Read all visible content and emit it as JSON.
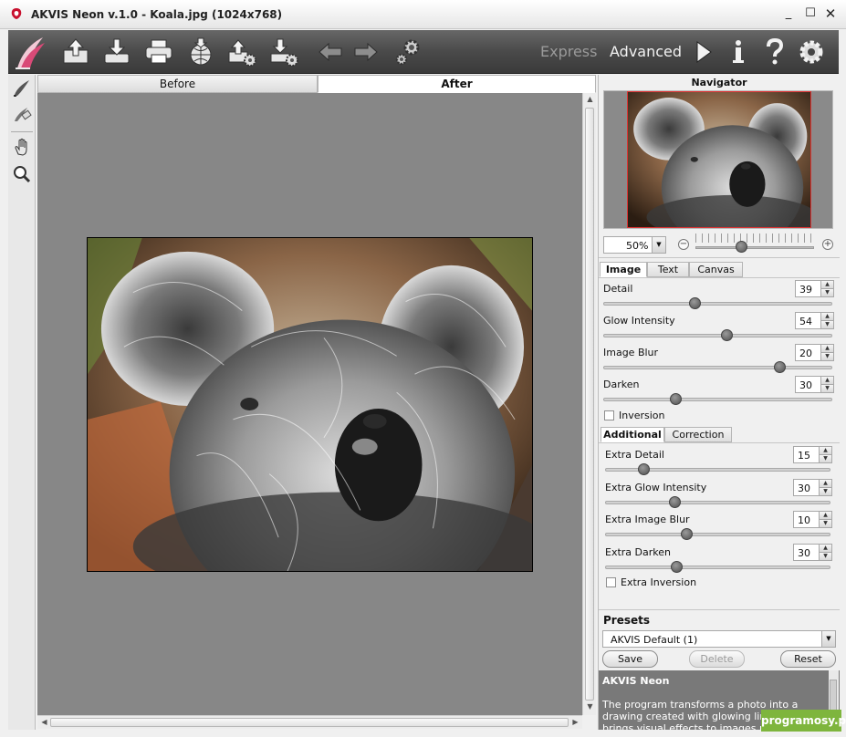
{
  "window": {
    "title": "AKVIS Neon v.1.0 - Koala.jpg (1024x768)",
    "minimize": "_",
    "maximize": "☐",
    "close": "✕"
  },
  "toolbar": {
    "mode_express": "Express",
    "mode_advanced": "Advanced"
  },
  "view_tabs": {
    "before": "Before",
    "after": "After"
  },
  "navigator": {
    "title": "Navigator",
    "zoom": "50%",
    "zoom_minus": "−",
    "zoom_plus": "+"
  },
  "image_tabs": [
    "Image",
    "Text",
    "Canvas"
  ],
  "image_params": [
    {
      "label": "Detail",
      "value": "39"
    },
    {
      "label": "Glow Intensity",
      "value": "54"
    },
    {
      "label": "Image Blur",
      "value": "20"
    },
    {
      "label": "Darken",
      "value": "30"
    }
  ],
  "inversion_label": "Inversion",
  "additional_tabs": [
    "Additional",
    "Correction"
  ],
  "additional_params": [
    {
      "label": "Extra Detail",
      "value": "15"
    },
    {
      "label": "Extra Glow Intensity",
      "value": "30"
    },
    {
      "label": "Extra Image Blur",
      "value": "10"
    },
    {
      "label": "Extra Darken",
      "value": "30"
    }
  ],
  "extra_inversion_label": "Extra Inversion",
  "presets": {
    "title": "Presets",
    "selected": "AKVIS Default (1)",
    "save": "Save",
    "delete": "Delete",
    "reset": "Reset"
  },
  "help": {
    "title": "AKVIS Neon",
    "text": "The program transforms a photo into a drawing created with glowing lines. It brings visual effects to images making them"
  },
  "watermark": "programosy.pl"
}
